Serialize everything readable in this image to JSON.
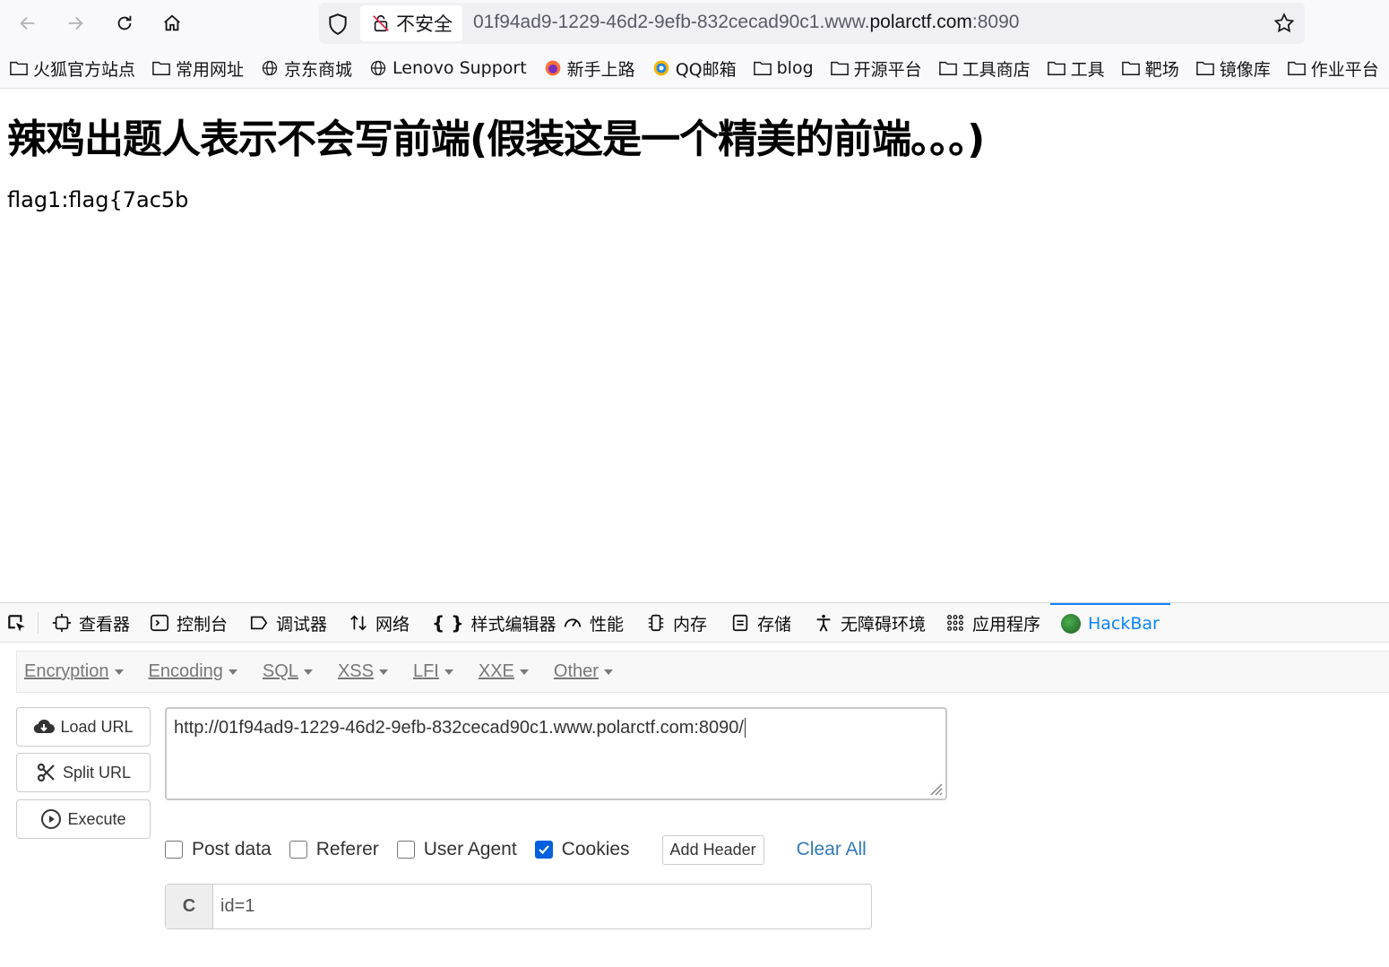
{
  "browser": {
    "security_label": "不安全",
    "url_prefix": "01f94ad9-1229-46d2-9efb-832cecad90c1.www.",
    "url_domain": "polarctf.com",
    "url_suffix": ":8090"
  },
  "bookmarks": [
    {
      "label": "火狐官方站点",
      "icon": "folder-icon"
    },
    {
      "label": "常用网址",
      "icon": "folder-icon"
    },
    {
      "label": "京东商城",
      "icon": "globe-icon"
    },
    {
      "label": "Lenovo Support",
      "icon": "globe-icon"
    },
    {
      "label": "新手上路",
      "icon": "firefox-icon"
    },
    {
      "label": "QQ邮箱",
      "icon": "qqmail-icon"
    },
    {
      "label": "blog",
      "icon": "folder-icon"
    },
    {
      "label": "开源平台",
      "icon": "folder-icon"
    },
    {
      "label": "工具商店",
      "icon": "folder-icon"
    },
    {
      "label": "工具",
      "icon": "folder-icon"
    },
    {
      "label": "靶场",
      "icon": "folder-icon"
    },
    {
      "label": "镜像库",
      "icon": "folder-icon"
    },
    {
      "label": "作业平台",
      "icon": "folder-icon"
    }
  ],
  "page": {
    "title": "辣鸡出题人表示不会写前端(假装这是一个精美的前端。。。)",
    "flag": "flag1:flag{7ac5b"
  },
  "devtools": {
    "tabs": [
      "查看器",
      "控制台",
      "调试器",
      "网络",
      "样式编辑器",
      "性能",
      "内存",
      "存储",
      "无障碍环境",
      "应用程序",
      "HackBar"
    ],
    "active_tab": "HackBar"
  },
  "hackbar": {
    "menu": [
      "Encryption",
      "Encoding",
      "SQL",
      "XSS",
      "LFI",
      "XXE",
      "Other"
    ],
    "load_url": "Load URL",
    "split_url": "Split URL",
    "execute": "Execute",
    "url_value": "http://01f94ad9-1229-46d2-9efb-832cecad90c1.www.polarctf.com:8090/",
    "options": {
      "post_data": "Post data",
      "referer": "Referer",
      "user_agent": "User Agent",
      "cookies": "Cookies",
      "post_data_checked": false,
      "referer_checked": false,
      "user_agent_checked": false,
      "cookies_checked": true
    },
    "add_header": "Add Header",
    "clear_all": "Clear All",
    "cookie_label": "C",
    "cookie_value": "id=1"
  }
}
